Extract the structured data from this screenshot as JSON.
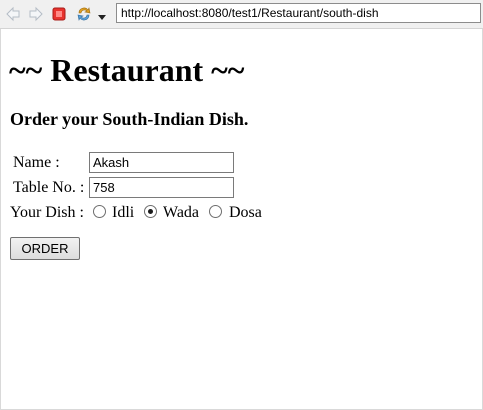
{
  "browser": {
    "url": "http://localhost:8080/test1/Restaurant/south-dish",
    "colors": {
      "stop": "#e8332e",
      "nav_arrows": "#c0c8d0",
      "refresh": "#e0a020"
    }
  },
  "page": {
    "title": "~~ Restaurant ~~",
    "subtitle": "Order your South-Indian Dish.",
    "form": {
      "name_label": "Name :",
      "name_value": "Akash",
      "table_label": "Table No. :",
      "table_value": "758",
      "dish_label": "Your Dish :",
      "dish_options": [
        {
          "label": "Idli",
          "checked": false
        },
        {
          "label": "Wada",
          "checked": true
        },
        {
          "label": "Dosa",
          "checked": false
        }
      ],
      "submit_label": "ORDER"
    }
  }
}
